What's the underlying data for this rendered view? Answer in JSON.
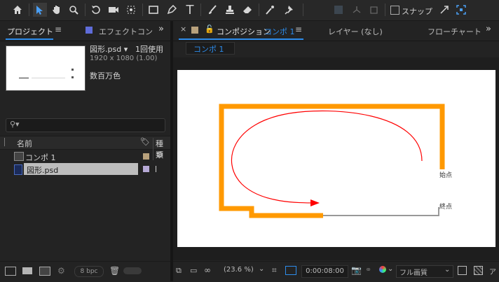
{
  "toolbar": {
    "icons": [
      "home-icon",
      "selection-tool-icon",
      "hand-tool-icon",
      "zoom-tool-icon",
      "rotate-tool-icon",
      "camera-tool-icon",
      "pan-behind-tool-icon",
      "rectangle-tool-icon",
      "pen-tool-icon",
      "type-tool-icon",
      "brush-tool-icon",
      "clone-stamp-tool-icon",
      "eraser-tool-icon",
      "roto-brush-icon",
      "puppet-pin-icon"
    ],
    "snap_label": "スナップ"
  },
  "project_panel": {
    "tab_label": "プロジェクト",
    "effects_tab_label": "エフェクトコン",
    "item_name": "図形.psd ▾",
    "usage": "1回使用",
    "dimensions": "1920 x 1080 (1.00)",
    "colors": "数百万色",
    "search_placeholder": "",
    "col_name": "名前",
    "col_type": "種類",
    "items": [
      {
        "name": "コンポ 1",
        "type": "comp",
        "color": "#b8a17c",
        "selected": false
      },
      {
        "name": "図形.psd",
        "type": "psd",
        "color": "#b6a9d6",
        "selected": true
      }
    ],
    "bpc": "8 bpc"
  },
  "comp_panel": {
    "tab_label": "コンポジション",
    "comp_name": "コンポ 1",
    "layer_tab": "レイヤー (なし)",
    "flowchart_tab": "フローチャート",
    "breadcrumb": "コンポ 1",
    "zoom": "(23.6 %)",
    "timecode": "0:00:08:00",
    "quality": "フル画質",
    "start_label": "始点",
    "end_label": "終点",
    "accent_color": "#2d8ceb",
    "path_color": "#ff9900",
    "curve_color": "#ff0000"
  }
}
